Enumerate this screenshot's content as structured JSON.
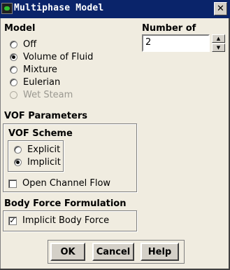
{
  "window": {
    "title": "Multiphase Model",
    "close_icon": "close-icon",
    "app_icon": "fluent-app-icon"
  },
  "model": {
    "label": "Model",
    "options": [
      {
        "label": "Off",
        "selected": false,
        "enabled": true
      },
      {
        "label": "Volume of Fluid",
        "selected": true,
        "enabled": true
      },
      {
        "label": "Mixture",
        "selected": false,
        "enabled": true
      },
      {
        "label": "Eulerian",
        "selected": false,
        "enabled": true
      },
      {
        "label": "Wet Steam",
        "selected": false,
        "enabled": false
      }
    ]
  },
  "phases": {
    "label": "Number of Phases",
    "value": "2"
  },
  "vof": {
    "label": "VOF Parameters",
    "scheme_label": "VOF Scheme",
    "schemes": [
      {
        "label": "Explicit",
        "selected": false
      },
      {
        "label": "Implicit",
        "selected": true
      }
    ],
    "open_channel": {
      "label": "Open Channel Flow",
      "checked": false
    }
  },
  "body_force": {
    "label": "Body Force Formulation",
    "implicit": {
      "label": "Implicit Body Force",
      "checked": true
    }
  },
  "buttons": {
    "ok": "OK",
    "cancel": "Cancel",
    "help": "Help"
  },
  "colors": {
    "titlebar": "#0a246a",
    "dialog_bg": "#f0ece0",
    "disabled_text": "#9a9890"
  }
}
